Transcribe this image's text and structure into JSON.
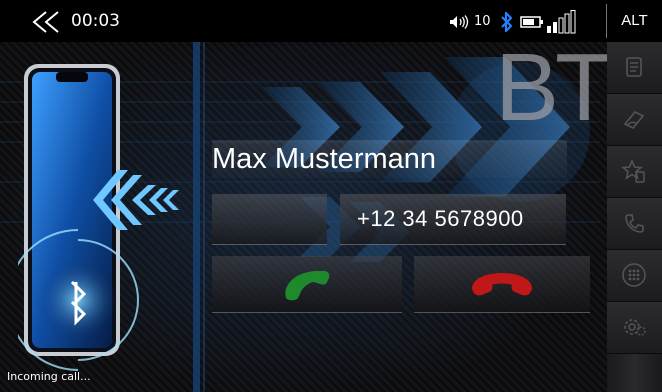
{
  "status_bar": {
    "call_timer": "00:03",
    "volume_level": "10",
    "alt_label": "ALT"
  },
  "call": {
    "contact_name": "Max Mustermann",
    "phone_number": "+12 34 5678900",
    "status_text": "Incoming call..."
  },
  "branding": {
    "bt_watermark": "BT"
  },
  "colors": {
    "accept_green": "#1f8a2c",
    "decline_red": "#c01818",
    "bluetooth_blue": "#2a7fff",
    "accent_blue": "#3c8ad8"
  },
  "icons": {
    "back": "double-chevron-left-icon",
    "volume": "speaker-icon",
    "bluetooth": "bluetooth-icon",
    "battery": "battery-icon",
    "signal": "signal-bars-icon",
    "sidebar": [
      "phonebook-icon",
      "call-history-icon",
      "favorites-icon",
      "redial-icon",
      "dialpad-icon",
      "settings-icon"
    ]
  }
}
